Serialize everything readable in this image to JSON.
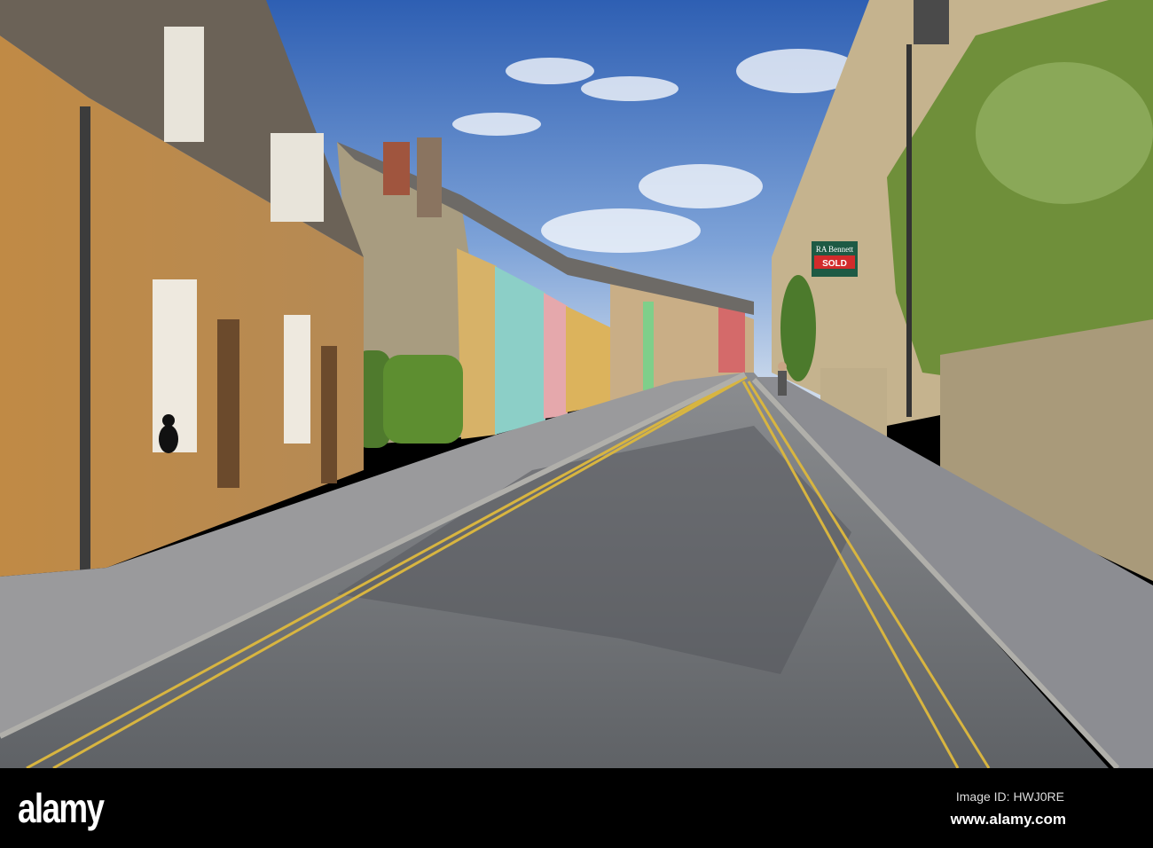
{
  "photo": {
    "subject": "Street scene",
    "sign": {
      "brand": "RA Bennett",
      "status": "SOLD"
    },
    "colors": {
      "sky": "#3f73c2",
      "stone": "#c99a55",
      "road": "#6e7176",
      "line": "#d8b540",
      "foliage": "#6f8f3a"
    }
  },
  "watermark": {
    "logo": "alamy",
    "image_id": "Image ID: HWJ0RE",
    "site": "www.alamy.com"
  }
}
